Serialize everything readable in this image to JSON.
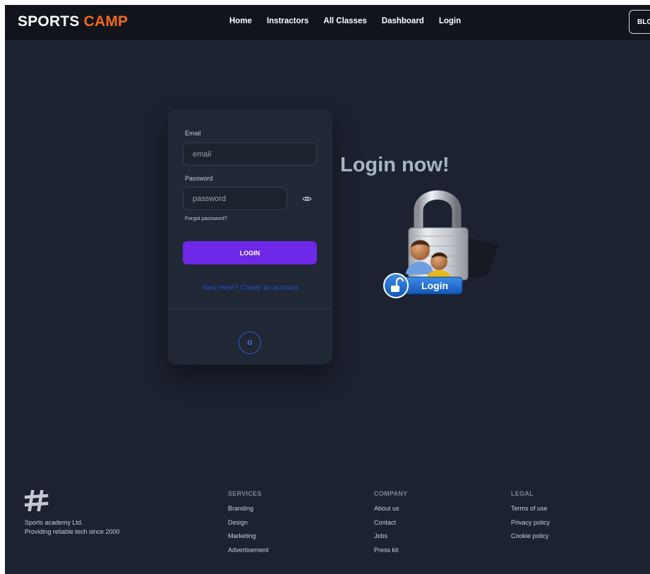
{
  "navbar": {
    "brand_part1": "SPORTS",
    "brand_part2": "CAMP",
    "links": [
      "Home",
      "Instractors",
      "All Classes",
      "Dashboard",
      "Login"
    ],
    "blog_label": "BLOG"
  },
  "login_form": {
    "email_label": "Email",
    "email_placeholder": "email",
    "password_label": "Password",
    "password_placeholder": "password",
    "password_toggle_icon": "eye-icon",
    "forgot_link": "Forgot password?",
    "submit_label": "LOGIN",
    "signup_link": "New Here? Create an account",
    "google_label": "G"
  },
  "hero": {
    "title": "Login now!",
    "illustration_button_text": "Login"
  },
  "footer": {
    "logo_icon": "hashtag-icon",
    "company_name": "Sports academy Ltd.",
    "company_tagline": "Providing reliable tech since 2000",
    "services": {
      "heading": "SERVICES",
      "links": [
        "Branding",
        "Design",
        "Marketing",
        "Advertisement"
      ]
    },
    "company": {
      "heading": "COMPANY",
      "links": [
        "About us",
        "Contact",
        "Jobs",
        "Press kit"
      ]
    },
    "legal": {
      "heading": "LEGAL",
      "links": [
        "Terms of use",
        "Privacy policy",
        "Cookie policy"
      ]
    }
  },
  "colors": {
    "page_background": "#1c2230",
    "navbar_background": "#11141b",
    "brand_accent": "#f26a1b",
    "primary_button": "#6d28e8",
    "link_blue": "#1f4fd0",
    "card_background": "#202735",
    "hero_title": "#a7b4c6"
  }
}
